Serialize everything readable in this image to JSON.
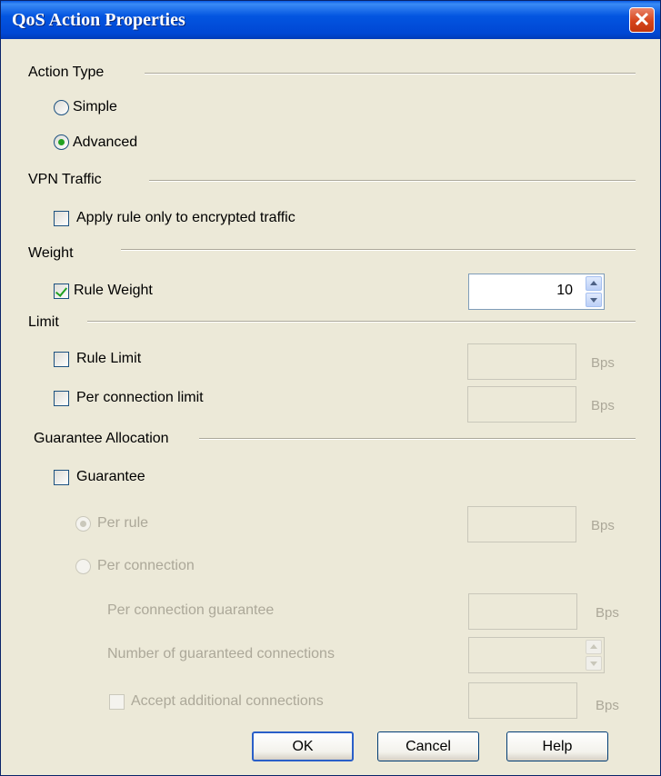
{
  "window": {
    "title": "QoS Action Properties",
    "close_glyph": "✕"
  },
  "sections": {
    "action_type": {
      "label": "Action Type",
      "options": [
        {
          "label": "Simple",
          "selected": false
        },
        {
          "label": "Advanced",
          "selected": true
        }
      ]
    },
    "vpn_traffic": {
      "label": "VPN Traffic",
      "encrypted_only": {
        "label": "Apply rule only to encrypted traffic",
        "checked": false
      }
    },
    "weight": {
      "label": "Weight",
      "rule_weight": {
        "label": "Rule Weight",
        "checked": true,
        "value": "10"
      }
    },
    "limit": {
      "label": "Limit",
      "rule_limit": {
        "label": "Rule Limit",
        "checked": false,
        "value": "",
        "unit": "Bps"
      },
      "per_connection_limit": {
        "label": "Per connection limit",
        "checked": false,
        "value": "",
        "unit": "Bps"
      }
    },
    "guarantee_allocation": {
      "label": "Guarantee Allocation",
      "guarantee": {
        "label": "Guarantee",
        "checked": false
      },
      "per_rule": {
        "label": "Per rule",
        "selected": true,
        "value": "",
        "unit": "Bps"
      },
      "per_connection": {
        "label": "Per connection",
        "selected": false
      },
      "per_connection_guarantee": {
        "label": "Per connection guarantee",
        "value": "",
        "unit": "Bps"
      },
      "number_of_guaranteed_connections": {
        "label": "Number of guaranteed connections",
        "value": ""
      },
      "accept_additional_connections": {
        "label": "Accept additional connections",
        "checked": false,
        "value": "",
        "unit": "Bps"
      }
    }
  },
  "buttons": {
    "ok": "OK",
    "cancel": "Cancel",
    "help": "Help"
  },
  "colors": {
    "titlebar": "#0355e0",
    "dialog_bg": "#ece9d8",
    "check_green": "#21a121",
    "disabled_text": "#aca899"
  }
}
